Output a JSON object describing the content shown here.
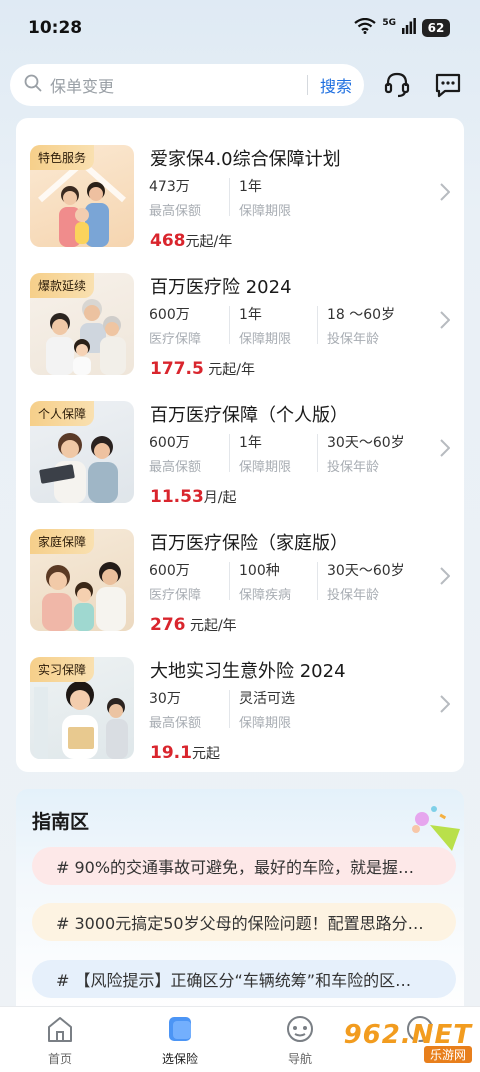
{
  "status_bar": {
    "time": "10:28",
    "network": "5G",
    "battery": "62"
  },
  "search": {
    "placeholder": "保单变更",
    "button_label": "搜索"
  },
  "products": [
    {
      "tag": "特色服务",
      "title": "爱家保4.0综合保障计划",
      "specs": [
        {
          "value": "473万",
          "label": "最高保额"
        },
        {
          "value": "1年",
          "label": "保障期限"
        }
      ],
      "price": "468",
      "price_unit": "元起/年"
    },
    {
      "tag": "爆款延续",
      "title": "百万医疗险 2024",
      "specs": [
        {
          "value": "600万",
          "label": "医疗保障"
        },
        {
          "value": "1年",
          "label": "保障期限"
        },
        {
          "value": "18 ～60岁",
          "label": "投保年龄"
        }
      ],
      "price": "177.5",
      "price_unit": " 元起/年"
    },
    {
      "tag": "个人保障",
      "title": "百万医疗保障（个人版）",
      "specs": [
        {
          "value": "600万",
          "label": "最高保额"
        },
        {
          "value": "1年",
          "label": "保障期限"
        },
        {
          "value": "30天～60岁",
          "label": "投保年龄"
        }
      ],
      "price": "11.53",
      "price_unit": "月/起"
    },
    {
      "tag": "家庭保障",
      "title": "百万医疗保险（家庭版）",
      "specs": [
        {
          "value": "600万",
          "label": "医疗保障"
        },
        {
          "value": "100种",
          "label": "保障疾病"
        },
        {
          "value": "30天～60岁",
          "label": "投保年龄"
        }
      ],
      "price": "276",
      "price_unit": " 元起/年"
    },
    {
      "tag": "实习保障",
      "title": "大地实习生意外险 2024",
      "specs": [
        {
          "value": "30万",
          "label": "最高保额"
        },
        {
          "value": "灵活可选",
          "label": "保障期限"
        }
      ],
      "price": "19.1",
      "price_unit": "元起"
    }
  ],
  "guide": {
    "title": "指南区",
    "items": [
      {
        "text": "# 90%的交通事故可避免，最好的车险，就是握…",
        "bg": "#fde8e8"
      },
      {
        "text": "# 3000元搞定50岁父母的保险问题！配置思路分…",
        "bg": "#fdf3e2"
      },
      {
        "text": "# 【风险提示】正确区分“车辆统筹”和车险的区…",
        "bg": "#e6f0fb"
      }
    ]
  },
  "bottom_nav": [
    {
      "label": "首页",
      "icon": "home-icon"
    },
    {
      "label": "选保险",
      "icon": "insurance-icon",
      "active": true
    },
    {
      "label": "导航",
      "icon": "navigation-icon"
    },
    {
      "label": "",
      "icon": "profile-icon"
    }
  ],
  "watermark": {
    "main": "962.NET",
    "sub": "乐游网"
  },
  "colors": {
    "accent": "#1e6fe0",
    "price": "#d9252d",
    "tag_bg": "#f6cf8a",
    "watermark": "#f29c1f"
  }
}
